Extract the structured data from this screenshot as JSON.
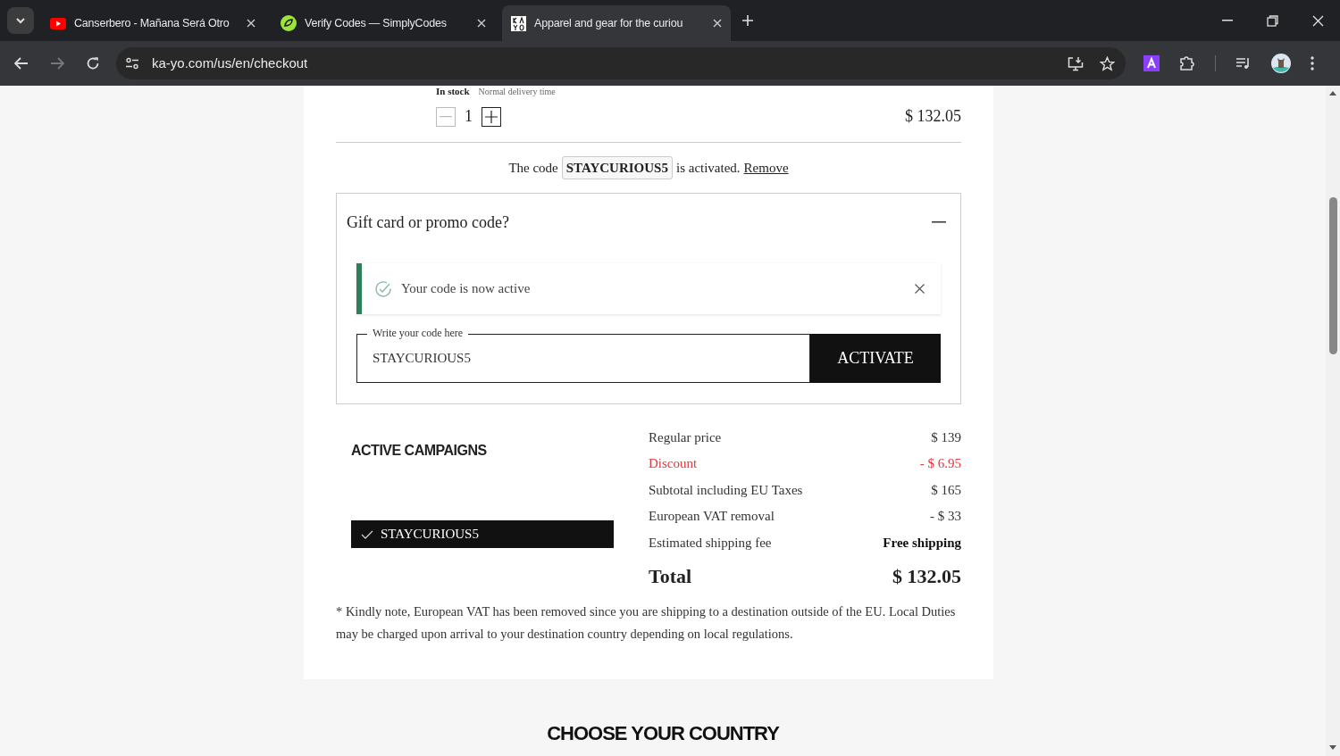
{
  "browser": {
    "tabs": [
      {
        "title": "Canserbero - Mañana Será Otro",
        "selected": false
      },
      {
        "title": "Verify Codes — SimplyCodes",
        "selected": false
      },
      {
        "title": "Apparel and gear for the curiou",
        "selected": true
      }
    ],
    "url": "ka-yo.com/us/en/checkout"
  },
  "item": {
    "stock": "In stock",
    "delivery": "Normal delivery time",
    "quantity": "1",
    "price": "$ 132.05"
  },
  "code_notice": {
    "prefix": "The code",
    "code": "STAYCURIOUS5",
    "suffix": "is activated.",
    "link": "Remove"
  },
  "promo": {
    "title": "Gift card or promo code?",
    "expanded": true,
    "alert": "Your code is now active",
    "field": {
      "label": "Write your code here",
      "value": "STAYCURIOUS5"
    },
    "button": "ACTIVATE"
  },
  "campaigns": {
    "title": "ACTIVE CAMPAIGNS",
    "items": [
      {
        "code": "STAYCURIOUS5",
        "checked": true
      }
    ]
  },
  "summary": [
    {
      "label": "Regular price",
      "value": "$ 139",
      "kind": "normal"
    },
    {
      "label": "Discount",
      "value": "- $ 6.95",
      "kind": "discount"
    },
    {
      "label": "Subtotal including EU Taxes",
      "value": "$ 165",
      "kind": "normal"
    },
    {
      "label": "European VAT removal",
      "value": "- $ 33",
      "kind": "normal"
    },
    {
      "label": "Estimated shipping fee",
      "value": "Free shipping",
      "kind": "strong"
    }
  ],
  "total": {
    "label": "Total",
    "value": "$ 132.05"
  },
  "note": "* Kindly note, European VAT has been removed since you are shipping to a destination outside of the EU. Local Duties may be charged upon arrival to your destination country depending on local regulations.",
  "country_heading": "CHOOSE YOUR COUNTRY"
}
